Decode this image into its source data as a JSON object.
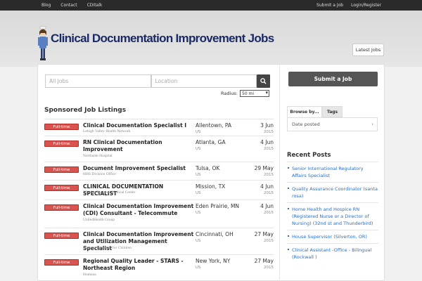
{
  "topbar": {
    "left": [
      "Blog",
      "Contact",
      "CDItalk"
    ],
    "right": [
      "Submit a Job",
      "Login/Register"
    ]
  },
  "header": {
    "title": "Clinical Documentation Improvement Jobs",
    "latest_jobs": "Latest Jobs"
  },
  "search": {
    "keywords_placeholder": "All Jobs",
    "location_placeholder": "Location",
    "radius_label": "Radius:",
    "radius_value": "50 mi"
  },
  "listings": {
    "title": "Sponsored Job Listings",
    "jobs": [
      {
        "type": "Full-time",
        "title": "Clinical Documentation Specialist I",
        "company": "Lehigh Valley Health Network",
        "location": "Allentown, PA",
        "country": "US",
        "date": "3 Jun",
        "year": "2015"
      },
      {
        "type": "Full-time",
        "title": "RN Clinical Documentation Improvement",
        "company": "Northside Hospital",
        "location": "Atlanta, GA",
        "country": "US",
        "date": "4 Jun",
        "year": "2015"
      },
      {
        "type": "Full-time",
        "title": "Document Improvement Specialist",
        "company": "HHS Division Office",
        "location": "Tulsa, OK",
        "country": "US",
        "date": "29 May",
        "year": "2015"
      },
      {
        "type": "Full-time",
        "title": "CLINICAL DOCUMENTATION SPECIALIST",
        "company": "Mission Regional Medical Center",
        "location": "Mission, TX",
        "country": "US",
        "date": "4 Jun",
        "year": "2015"
      },
      {
        "type": "Full-time",
        "title": "Clinical Documentation Improvement (CDI) Consultant - Telecommute",
        "company": "UnitedHealth Group",
        "location": "Eden Prairie, MN",
        "country": "US",
        "date": "4 Jun",
        "year": "2015"
      },
      {
        "type": "Full-time",
        "title": "Clinical Documentation Improvement and Utilization Management Specialist",
        "company": "Shriners Hospitals for Children",
        "location": "Cincinnati, OH",
        "country": "US",
        "date": "27 May",
        "year": "2015"
      },
      {
        "type": "Full-time",
        "title": "Regional Quality Leader - STARS - Northeast Region",
        "company": "Humana",
        "location": "New York, NY",
        "country": "US",
        "date": "27 May",
        "year": "2015"
      }
    ]
  },
  "sidebar": {
    "submit_button": "Submit a Job",
    "tabs": [
      "Browse by...",
      "Tags"
    ],
    "browse_item": "Date posted",
    "recent_title": "Recent Posts",
    "recent_posts": [
      "Senior International Regulatory Affairs Specialist",
      "Quality Assurance Coordinator (santa rosa)",
      "Home Health and Hospice RN (Registered Nurse or a Director of Nursing) (32nd st and Thunderbird)",
      "House Supervisor (Silverton, OR)",
      "Clinical Assistant -Office - Bilingual (Rockwall )"
    ]
  },
  "colors": {
    "badge": "#d9534f",
    "link": "#2a6ebb",
    "title": "#1a2a66",
    "topbar": "#2a2a2a"
  }
}
